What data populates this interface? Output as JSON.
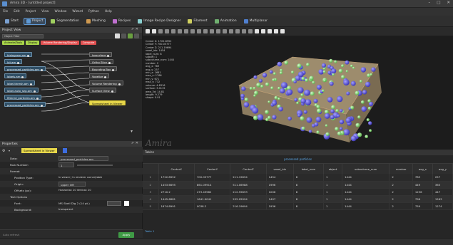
{
  "window": {
    "title": "Amira 3D - [untitled project]",
    "min": "–",
    "max": "□",
    "close": "✕"
  },
  "menu": [
    "File",
    "Edit",
    "Project",
    "View",
    "Window",
    "Wizard",
    "Python",
    "Help"
  ],
  "toolbar": [
    {
      "label": "Start",
      "color": "#7aa0d0"
    },
    {
      "label": "Project",
      "color": "#5f9ad6",
      "active": true
    },
    {
      "label": "Segmentation",
      "color": "#a0d060"
    },
    {
      "label": "Meshing",
      "color": "#d09a50"
    },
    {
      "label": "Recipes",
      "color": "#c070d0"
    },
    {
      "label": "Image Recipe Designer",
      "color": "#8ad0d0"
    },
    {
      "label": "Filament",
      "color": "#d0d060"
    },
    {
      "label": "Animation",
      "color": "#70b070"
    },
    {
      "label": "Multiplanar",
      "color": "#5080d0"
    }
  ],
  "project_view": {
    "title": "Project View",
    "filter": "Object Filter",
    "tags": [
      {
        "label": "Animate/Tools",
        "kind": "g"
      },
      {
        "label": "Display",
        "kind": "g"
      },
      {
        "label": "Volume Rendering/Display",
        "kind": "r"
      },
      {
        "label": "Compute",
        "kind": "r"
      }
    ],
    "left_nodes": [
      "histogram.am",
      "lut.am",
      "processed_particles.am",
      "labels.am",
      "label.thresh.am",
      "label.auto_sep.am",
      "filtered_particles.am",
      "processed_particles.am"
    ],
    "right_nodes": [
      "Isosurface",
      "Ortho Slice",
      "Bounding Box",
      "Voxelize",
      "Volume Rendering",
      "Surface View",
      "Spreadsheet in Viewer"
    ]
  },
  "properties": {
    "title": "Properties",
    "selected_module": "Spreadsheet in Viewer",
    "rows": [
      {
        "label": "Data:",
        "value": "processed_particles.am"
      },
      {
        "label": "Row Number:",
        "value": "1"
      },
      {
        "label": "Format",
        "value": ""
      },
      {
        "label": "Position Type:",
        "value": "In viewer | In renderer corner/table"
      },
      {
        "label": "Origin:",
        "value": "upper left"
      },
      {
        "label": "Offsets (px):",
        "value": "Horizontal: 20  Vertical: 20"
      },
      {
        "label": "Text Options",
        "value": ""
      },
      {
        "label": "Font:",
        "value": "MS Shell Dlg 2 (14 pt.)"
      },
      {
        "label": "Background:",
        "value": "transparent"
      }
    ],
    "apply_label": "Apply",
    "auto_refresh_label": "Auto refresh"
  },
  "viewer": {
    "info": "Center X: 1722.8952\nCenter Y: 700.05777\nCenter Z: 211.19694\nvoxel_idx: 1454\nlabel_num: 8\nsubset: 1\nsubvolume_num: 1444\nnumber: 2\navg_x: 783\navg_y: 257\nmin_x: 1681\nmax_x: 1766\nmin_y: 671\nmax_y: 732\nvolume: 4.8316\nsurface: 3.0115\narea_3d: 14.81\nlength: 9.279\nshape: 0.91",
    "watermark": "Amira"
  },
  "tables": {
    "title": "Tables",
    "tab": "processed particles",
    "columns": [
      "",
      "CenterX",
      "CenterY",
      "CenterZ",
      "voxel_idx",
      "label_num",
      "object",
      "subvolume_num",
      "number",
      "avg_x",
      "avg_y"
    ],
    "rows": [
      [
        "1",
        "1722.8952",
        "700.05777",
        "211.19694",
        "1454",
        "8",
        "1",
        "1444",
        "2",
        "783",
        "257"
      ],
      [
        "2",
        "1453.6695",
        "861.09914",
        "511.06988",
        "1996",
        "8",
        "1",
        "1444",
        "2",
        "449",
        "365"
      ],
      [
        "3",
        "2710.2",
        "473.49982",
        "212.59693",
        "1006",
        "8",
        "1",
        "1444",
        "2",
        "1236",
        "447"
      ],
      [
        "4",
        "1445.6881",
        "1641.9041",
        "252.05994",
        "1407",
        "8",
        "1",
        "1444",
        "2",
        "796",
        "1563"
      ],
      [
        "5",
        "1674.8991",
        "0038.2",
        "216.19694",
        "1936",
        "8",
        "1",
        "1444",
        "2",
        "759",
        "1274"
      ]
    ],
    "footer": "Table 1"
  }
}
